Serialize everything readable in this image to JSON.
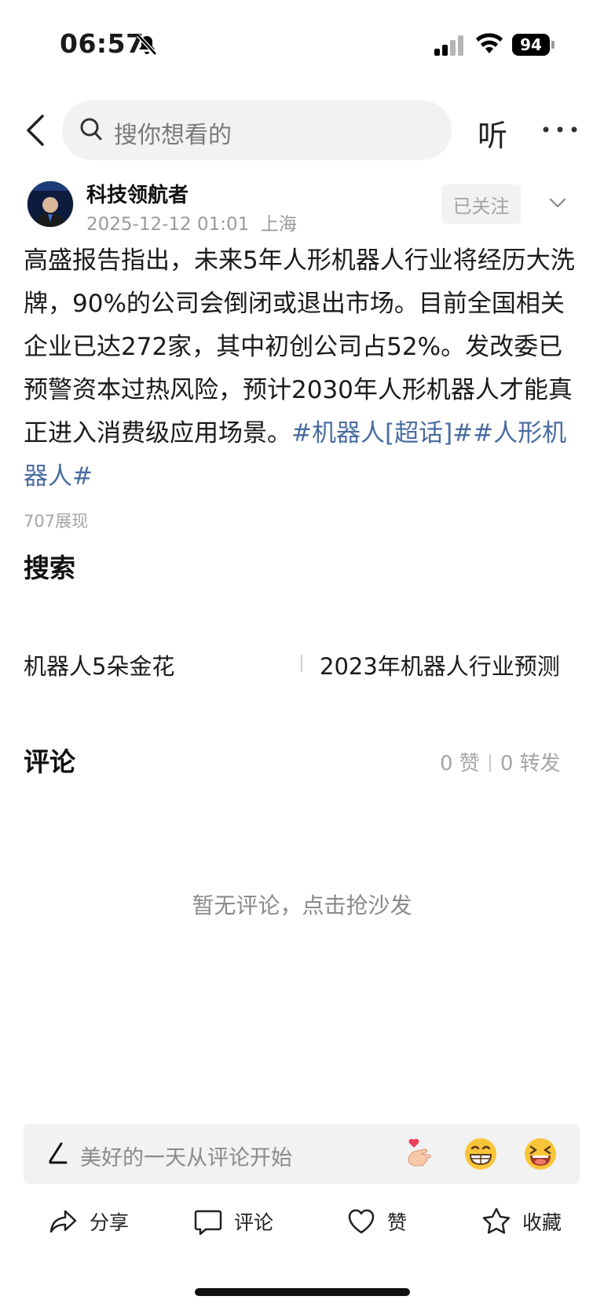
{
  "status_bar": {
    "time": "06:57",
    "battery": "94"
  },
  "nav": {
    "search_placeholder": "搜你想看的",
    "listen_label": "听"
  },
  "author": {
    "name": "科技领航者",
    "date": "2025-12-12 01:01",
    "location": "上海",
    "follow_label": "已关注"
  },
  "post": {
    "text": "高盛报告指出，未来5年人形机器人行业将经历大洗牌，90%的公司会倒闭或退出市场。目前全国相关企业已达272家，其中初创公司占52%。发改委已预警资本过热风险，预计2030年人形机器人才能真正进入消费级应用场景。",
    "tags": "#机器人[超话]##人形机器人#",
    "views": "707展现"
  },
  "search_section": {
    "title": "搜索",
    "items": [
      "机器人5朵金花",
      "2023年机器人行业预测"
    ]
  },
  "comments": {
    "title": "评论",
    "likes": "0 赞",
    "reposts": "0 转发",
    "empty_text": "暂无评论，点击抢沙发",
    "input_placeholder": "美好的一天从评论开始"
  },
  "actions": {
    "share": "分享",
    "comment": "评论",
    "like": "赞",
    "favorite": "收藏"
  }
}
